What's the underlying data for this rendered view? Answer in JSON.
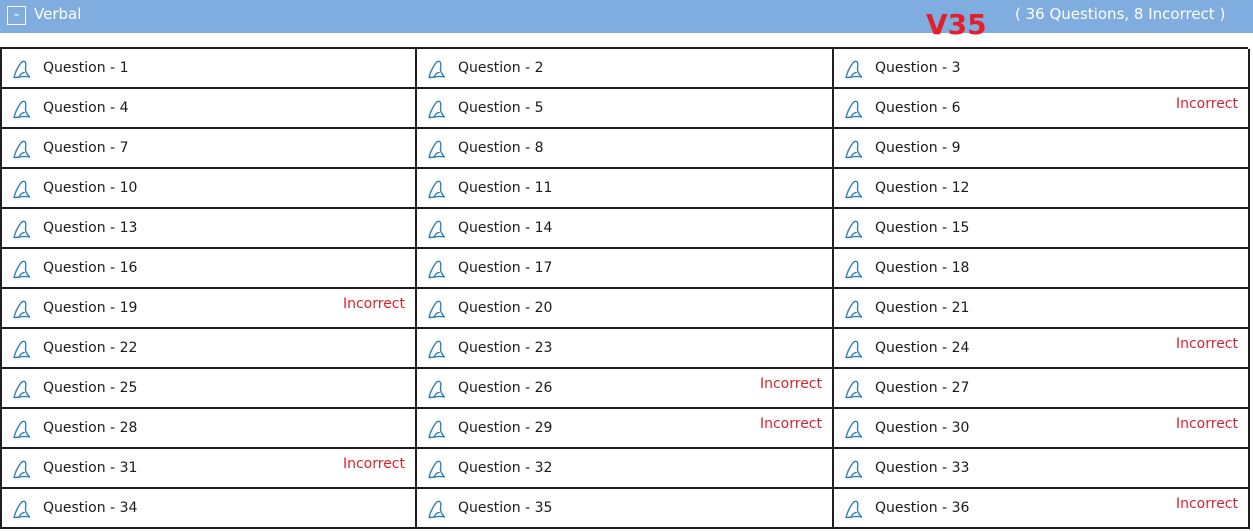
{
  "section": {
    "collapse_symbol": "-",
    "title": "Verbal",
    "version": "V35",
    "summary": "( 36 Questions, 8 Incorrect )"
  },
  "icon_name": "question-shape-icon",
  "colors": {
    "header_bg": "#80addf",
    "incorrect": "#d8232a",
    "version": "#e41e2b",
    "icon": "#2f7fb5"
  },
  "questions": [
    {
      "label": "Question - 1",
      "status": ""
    },
    {
      "label": "Question - 2",
      "status": ""
    },
    {
      "label": "Question - 3",
      "status": ""
    },
    {
      "label": "Question - 4",
      "status": ""
    },
    {
      "label": "Question - 5",
      "status": ""
    },
    {
      "label": "Question - 6",
      "status": "Incorrect"
    },
    {
      "label": "Question - 7",
      "status": ""
    },
    {
      "label": "Question - 8",
      "status": ""
    },
    {
      "label": "Question - 9",
      "status": ""
    },
    {
      "label": "Question - 10",
      "status": ""
    },
    {
      "label": "Question - 11",
      "status": ""
    },
    {
      "label": "Question - 12",
      "status": ""
    },
    {
      "label": "Question - 13",
      "status": ""
    },
    {
      "label": "Question - 14",
      "status": ""
    },
    {
      "label": "Question - 15",
      "status": ""
    },
    {
      "label": "Question - 16",
      "status": ""
    },
    {
      "label": "Question - 17",
      "status": ""
    },
    {
      "label": "Question - 18",
      "status": ""
    },
    {
      "label": "Question - 19",
      "status": "Incorrect"
    },
    {
      "label": "Question - 20",
      "status": ""
    },
    {
      "label": "Question - 21",
      "status": ""
    },
    {
      "label": "Question - 22",
      "status": ""
    },
    {
      "label": "Question - 23",
      "status": ""
    },
    {
      "label": "Question - 24",
      "status": "Incorrect"
    },
    {
      "label": "Question - 25",
      "status": ""
    },
    {
      "label": "Question - 26",
      "status": "Incorrect"
    },
    {
      "label": "Question - 27",
      "status": ""
    },
    {
      "label": "Question - 28",
      "status": ""
    },
    {
      "label": "Question - 29",
      "status": "Incorrect"
    },
    {
      "label": "Question - 30",
      "status": "Incorrect"
    },
    {
      "label": "Question - 31",
      "status": "Incorrect"
    },
    {
      "label": "Question - 32",
      "status": ""
    },
    {
      "label": "Question - 33",
      "status": ""
    },
    {
      "label": "Question - 34",
      "status": ""
    },
    {
      "label": "Question - 35",
      "status": ""
    },
    {
      "label": "Question - 36",
      "status": "Incorrect"
    }
  ]
}
